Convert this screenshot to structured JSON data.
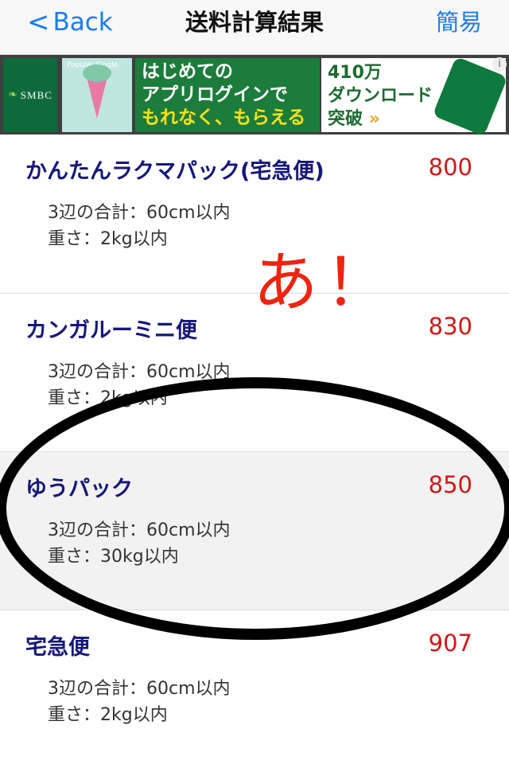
{
  "navbar": {
    "back_label": "Back",
    "back_chevron": "<",
    "title": "送料計算結果",
    "right_label": "簡易"
  },
  "ad": {
    "brand": "SMBC",
    "pic_text": "Popular Single",
    "copy_line1": "はじめての",
    "copy_line2": "アプリログインで",
    "copy_line3": "もれなく、もらえる",
    "right_line1": "410万",
    "right_line2": "ダウンロード",
    "right_line3": "突破",
    "right_arrow": "»",
    "info": "i"
  },
  "items": [
    {
      "name": "かんたんラクマパック(宅急便)",
      "price": "800",
      "size": "3辺の合計：60cm以内",
      "weight": "重さ：2kg以内"
    },
    {
      "name": "カンガルーミニ便",
      "price": "830",
      "size": "3辺の合計：60cm以内",
      "weight": "重さ：2kg以内"
    },
    {
      "name": "ゆうパック",
      "price": "850",
      "size": "3辺の合計：60cm以内",
      "weight": "重さ：30kg以内"
    },
    {
      "name": "宅急便",
      "price": "907",
      "size": "3辺の合計：60cm以内",
      "weight": "重さ：2kg以内"
    }
  ],
  "annotation": {
    "text": "あ！"
  },
  "colors": {
    "accent": "#1a7cf2",
    "name": "#16177a",
    "price": "#d51515",
    "annotation": "#ee2410"
  }
}
